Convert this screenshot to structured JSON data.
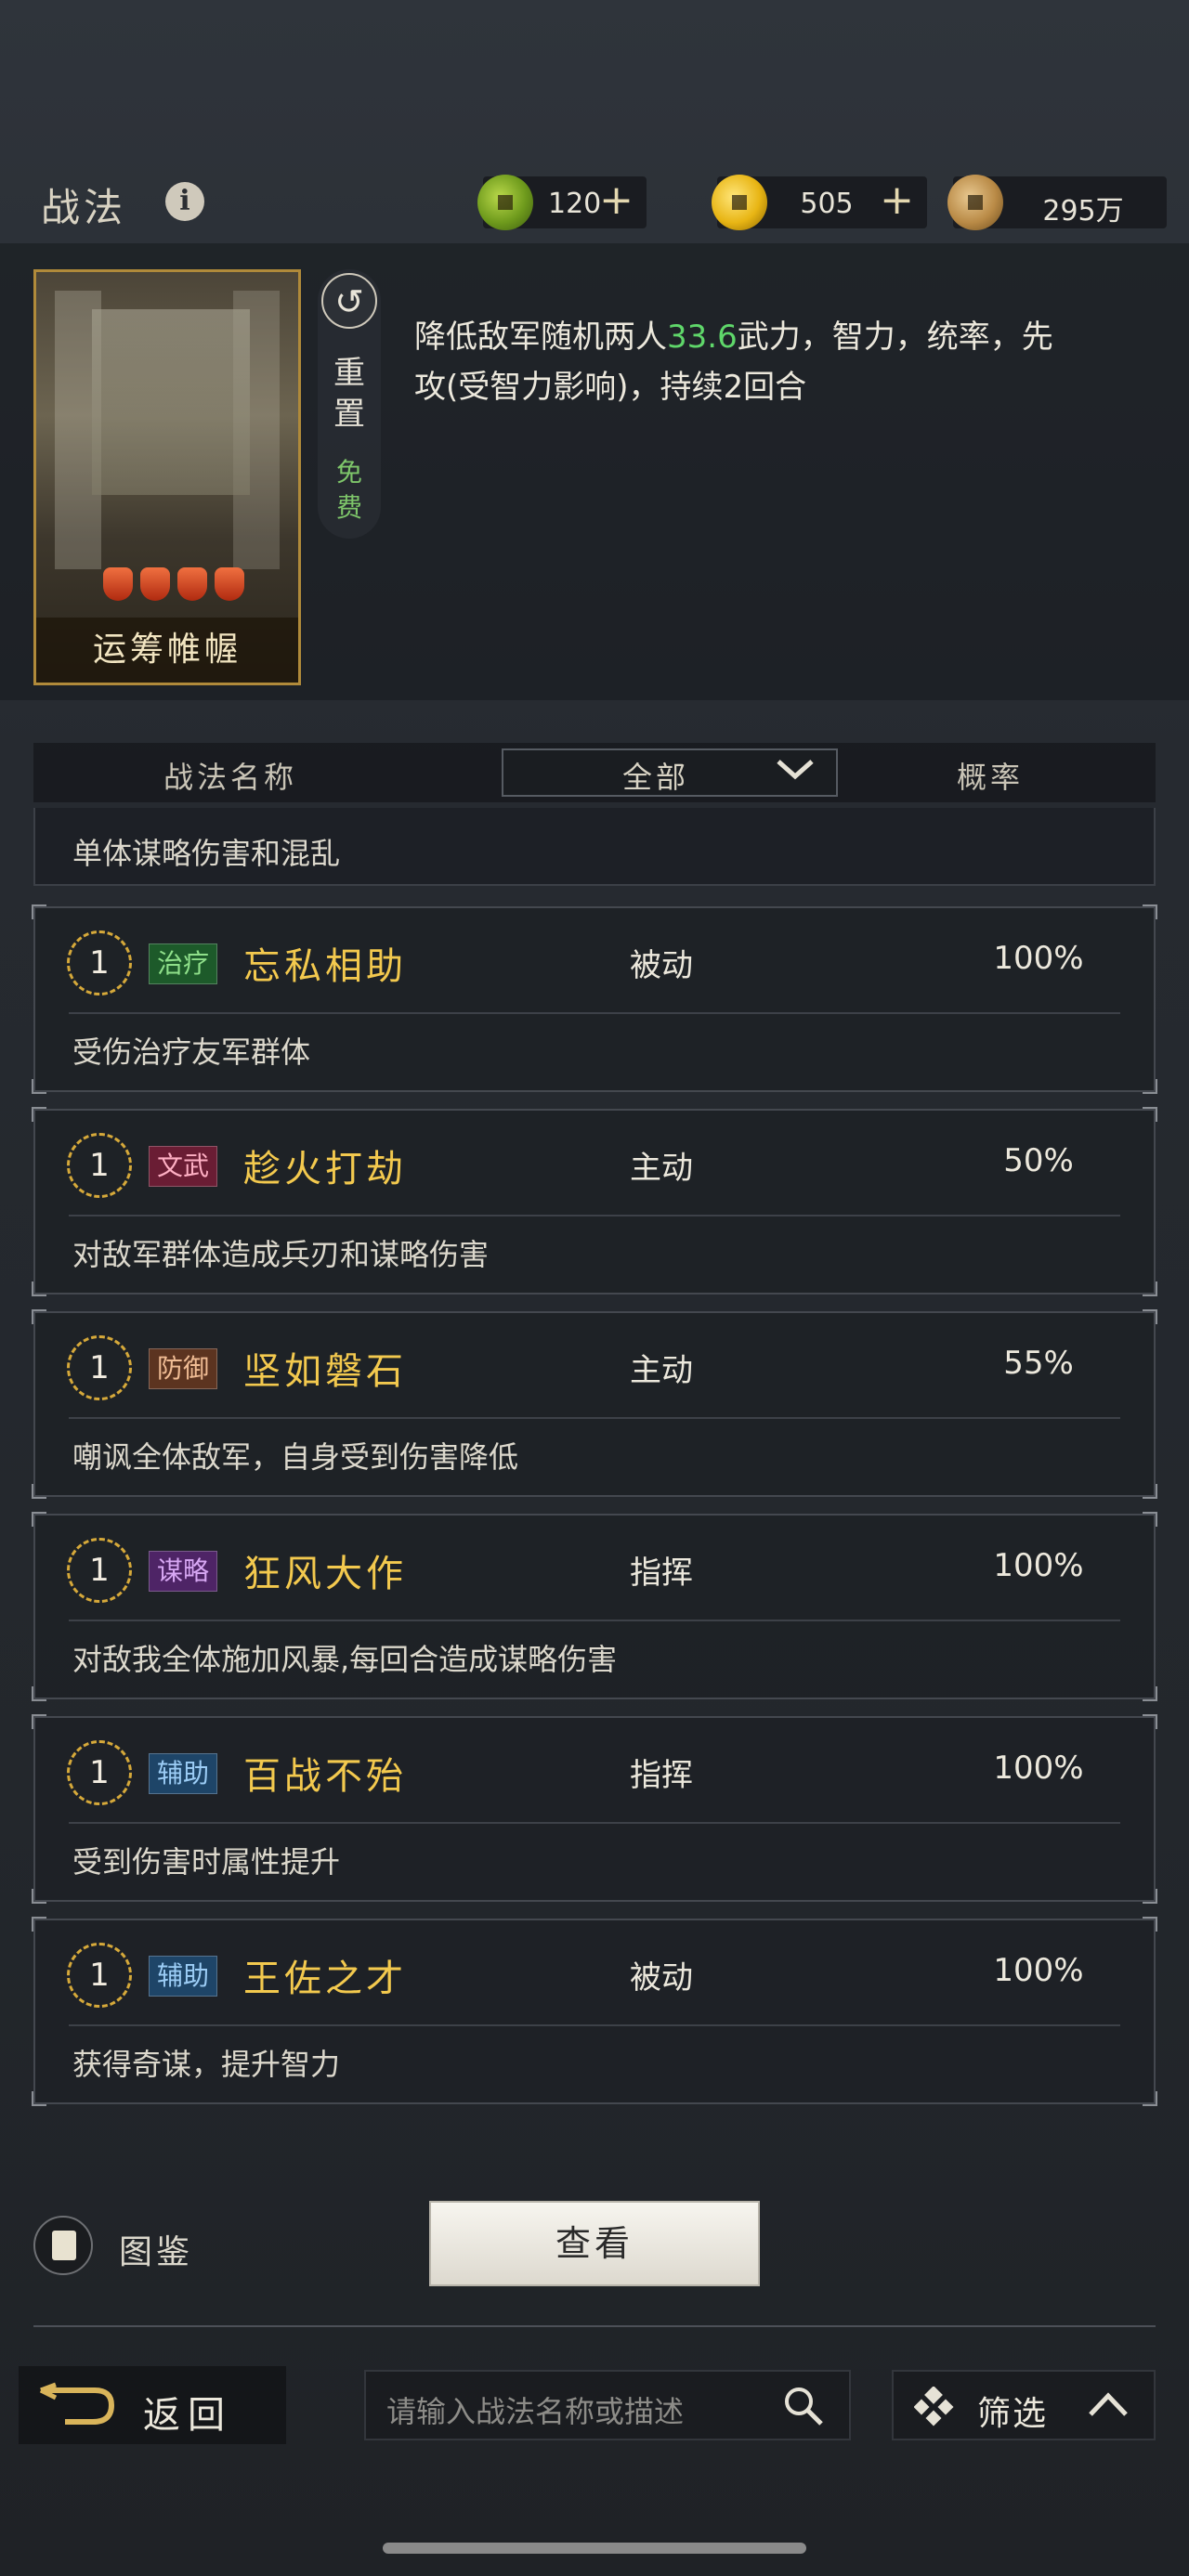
{
  "header": {
    "title": "战法",
    "info_icon": "info-icon",
    "currencies": [
      {
        "id": "jade",
        "icon": "jade-coin-icon",
        "value": "120",
        "plus": "+"
      },
      {
        "id": "gold",
        "icon": "gold-coin-icon",
        "value": "505",
        "plus": "+"
      },
      {
        "id": "copper",
        "icon": "copper-coin-icon",
        "value": "295万"
      }
    ]
  },
  "skill_card": {
    "name": "运筹帷幄",
    "quality_pips": 4,
    "reset_label": "重置",
    "reset_cost": "免费",
    "description_pre": "降低敌军随机两人",
    "description_value": "33.6",
    "description_post": "武力，智力，统率，先攻(受智力影响)，持续2回合",
    "highlight_color": "#5fd76a"
  },
  "list_header": {
    "name_col": "战法名称",
    "filter_value": "全部",
    "prob_col": "概率"
  },
  "partial_row_desc": "单体谋略伤害和混乱",
  "rows": [
    {
      "level": "1",
      "tag": "治疗",
      "tag_type": "heal",
      "name": "忘私相助",
      "type": "被动",
      "prob": "100%",
      "desc": "受伤治疗友军群体"
    },
    {
      "level": "1",
      "tag": "文武",
      "tag_type": "wenwu",
      "name": "趁火打劫",
      "type": "主动",
      "prob": "50%",
      "desc": "对敌军群体造成兵刃和谋略伤害"
    },
    {
      "level": "1",
      "tag": "防御",
      "tag_type": "def",
      "name": "坚如磐石",
      "type": "主动",
      "prob": "55%",
      "desc": "嘲讽全体敌军，自身受到伤害降低"
    },
    {
      "level": "1",
      "tag": "谋略",
      "tag_type": "strat",
      "name": "狂风大作",
      "type": "指挥",
      "prob": "100%",
      "desc": "对敌我全体施加风暴,每回合造成谋略伤害"
    },
    {
      "level": "1",
      "tag": "辅助",
      "tag_type": "aux",
      "name": "百战不殆",
      "type": "指挥",
      "prob": "100%",
      "desc": "受到伤害时属性提升"
    },
    {
      "level": "1",
      "tag": "辅助",
      "tag_type": "aux",
      "name": "王佐之才",
      "type": "被动",
      "prob": "100%",
      "desc": "获得奇谋，提升智力"
    }
  ],
  "footer": {
    "atlas_label": "图鉴",
    "view_button": "查看",
    "back_label": "返回",
    "search_placeholder": "请输入战法名称或描述",
    "filter_label": "筛选"
  }
}
